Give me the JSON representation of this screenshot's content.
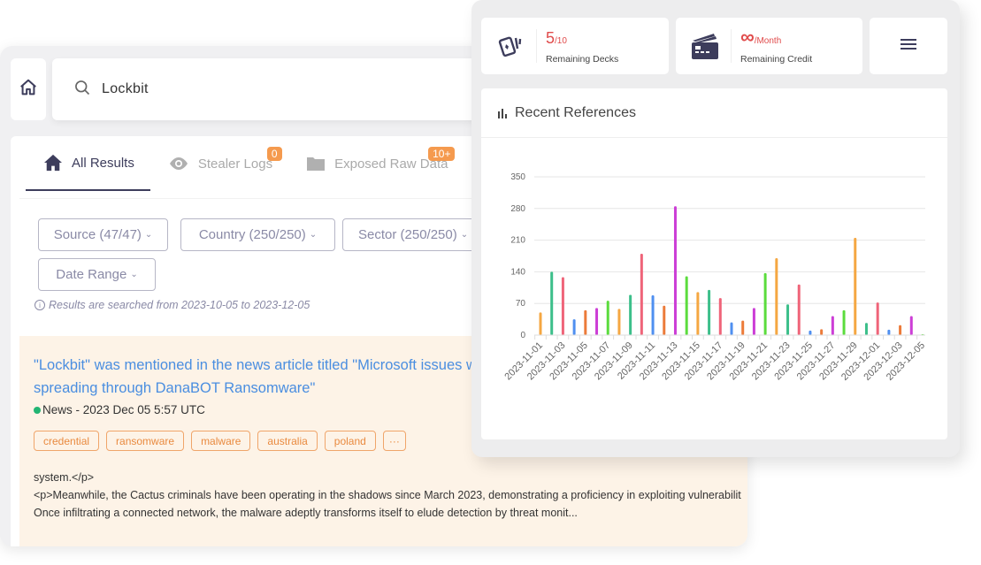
{
  "search": {
    "query": "Lockbit"
  },
  "tabs": [
    {
      "label": "All Results",
      "icon": "home-icon",
      "active": true,
      "badge": null
    },
    {
      "label": "Stealer Logs",
      "icon": "eye-icon",
      "active": false,
      "badge": "0"
    },
    {
      "label": "Exposed Raw Data",
      "icon": "folder-icon",
      "active": false,
      "badge": "10+"
    }
  ],
  "filters": {
    "source": "Source (47/47)",
    "country": "Country (250/250)",
    "sector": "Sector (250/250)",
    "date_range": "Date Range",
    "chevron": "⌄",
    "date_note": "Results are searched from 2023-10-05 to 2023-12-05"
  },
  "result": {
    "title_line1": "\"Lockbit\" was mentioned in the news article titled \"Microsoft issues warning on Cactus",
    "title_line2": "spreading through DanaBOT Ransomware\"",
    "meta": "News - 2023 Dec 05 5:57 UTC",
    "tags": [
      "credential",
      "ransomware",
      "malware",
      "australia",
      "poland",
      "···"
    ],
    "snippet_lines": [
      "system.</p>",
      "<p>Meanwhile, the Cactus criminals have been operating in the shadows since March 2023, demonstrating a proficiency in exploiting vulnerabilities",
      "Once infiltrating a connected network, the malware adeptly transforms itself to elude detection by threat monit..."
    ]
  },
  "stats": {
    "decks": {
      "value": "5",
      "total": "/10",
      "label": "Remaining Decks"
    },
    "credit": {
      "value": "∞",
      "suffix": "/Month",
      "label": "Remaining Credit"
    }
  },
  "colors": {
    "accent_red": "#e04b4b",
    "link_blue": "#4a8ee0",
    "badge_orange": "#f59a4e",
    "dark_navy": "#3d3d5c"
  },
  "chart_data": {
    "type": "bar",
    "title": "Recent References",
    "xlabel": "",
    "ylabel": "",
    "ylim": [
      0,
      350
    ],
    "yticks": [
      0,
      70,
      140,
      210,
      280,
      350
    ],
    "grid": true,
    "categories": [
      "2023-11-01",
      "2023-11-02",
      "2023-11-03",
      "2023-11-04",
      "2023-11-05",
      "2023-11-06",
      "2023-11-07",
      "2023-11-08",
      "2023-11-09",
      "2023-11-10",
      "2023-11-11",
      "2023-11-12",
      "2023-11-13",
      "2023-11-14",
      "2023-11-15",
      "2023-11-16",
      "2023-11-17",
      "2023-11-18",
      "2023-11-19",
      "2023-11-20",
      "2023-11-21",
      "2023-11-22",
      "2023-11-23",
      "2023-11-24",
      "2023-11-25",
      "2023-11-26",
      "2023-11-27",
      "2023-11-28",
      "2023-11-29",
      "2023-11-30",
      "2023-12-01",
      "2023-12-02",
      "2023-12-03",
      "2023-12-04",
      "2023-12-05"
    ],
    "tick_labels": [
      "2023-11-01",
      "2023-11-03",
      "2023-11-05",
      "2023-11-07",
      "2023-11-09",
      "2023-11-11",
      "2023-11-13",
      "2023-11-15",
      "2023-11-17",
      "2023-11-19",
      "2023-11-21",
      "2023-11-23",
      "2023-11-25",
      "2023-11-27",
      "2023-11-29",
      "2023-12-01",
      "2023-12-03",
      "2023-12-05"
    ],
    "values": [
      50,
      140,
      128,
      35,
      55,
      60,
      76,
      58,
      89,
      180,
      88,
      65,
      285,
      130,
      95,
      100,
      82,
      28,
      32,
      60,
      137,
      170,
      68,
      112,
      10,
      13,
      42,
      55,
      215,
      27,
      72,
      12,
      22,
      42,
      2
    ],
    "palette": [
      "#f5a742",
      "#3cbf8a",
      "#ef6479",
      "#4f8ff0",
      "#ec7b3a",
      "#cc3ed6",
      "#5bdc3d"
    ]
  }
}
